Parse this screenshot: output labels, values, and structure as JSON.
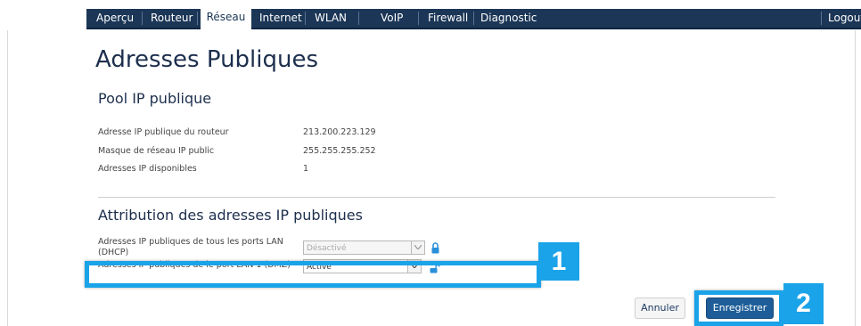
{
  "nav": {
    "items": [
      "Aperçu",
      "Routeur",
      "Réseau",
      "Internet",
      "WLAN",
      "VoIP",
      "Firewall",
      "Diagnostic"
    ],
    "active": "Réseau",
    "logout": "Logout"
  },
  "page": {
    "title": "Adresses Publiques"
  },
  "pool": {
    "title": "Pool IP publique",
    "rows": [
      {
        "label": "Adresse IP publique du routeur",
        "value": "213.200.223.129"
      },
      {
        "label": "Masque de réseau IP public",
        "value": "255.255.255.252"
      },
      {
        "label": "Adresses IP disponibles",
        "value": "1"
      }
    ]
  },
  "attribution": {
    "title": "Attribution des adresses IP publiques",
    "row1": {
      "label_line1": "Adresses IP publiques de tous les ports LAN",
      "label_line2": "(DHCP)",
      "value": "Désactivé"
    },
    "row2": {
      "label": "Adresses IP publiques de le port LAN 1 (DMZ)",
      "value": "Activé"
    }
  },
  "buttons": {
    "cancel": "Annuler",
    "save": "Enregistrer"
  },
  "annotations": {
    "badge1": "1",
    "badge2": "2",
    "highlight_color": "#1aa3e8"
  },
  "colors": {
    "nav_bg": "#1b3656",
    "title": "#1d2f4d",
    "primary_button": "#1e5d98"
  }
}
